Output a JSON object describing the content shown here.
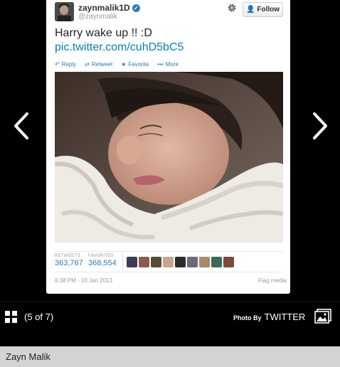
{
  "tweet": {
    "user_name": "zaynmalik1D",
    "user_handle": "@zaynmalik",
    "follow_label": "Follow",
    "text": "Harry wake up !! :D",
    "link": "pic.twitter.com/cuhD5bC5",
    "actions": {
      "reply": "Reply",
      "retweet": "Retweet",
      "favorite": "Favorite",
      "more": "More"
    },
    "stats": {
      "retweets_label": "RETWEETS",
      "retweets_value": "363,767",
      "favorites_label": "FAVORITES",
      "favorites_value": "368,554"
    },
    "timestamp": "6:38 PM - 10 Jan 2013",
    "flag_label": "Flag media"
  },
  "gallery": {
    "counter": "(5 of 7)",
    "photo_by_label": "Photo By",
    "photo_by_source": "TWITTER",
    "caption": "Zayn Malik"
  },
  "colors": {
    "link_blue": "#0084b4",
    "action_blue": "#2b7bb9",
    "caption_bg": "#d4d4d4"
  }
}
